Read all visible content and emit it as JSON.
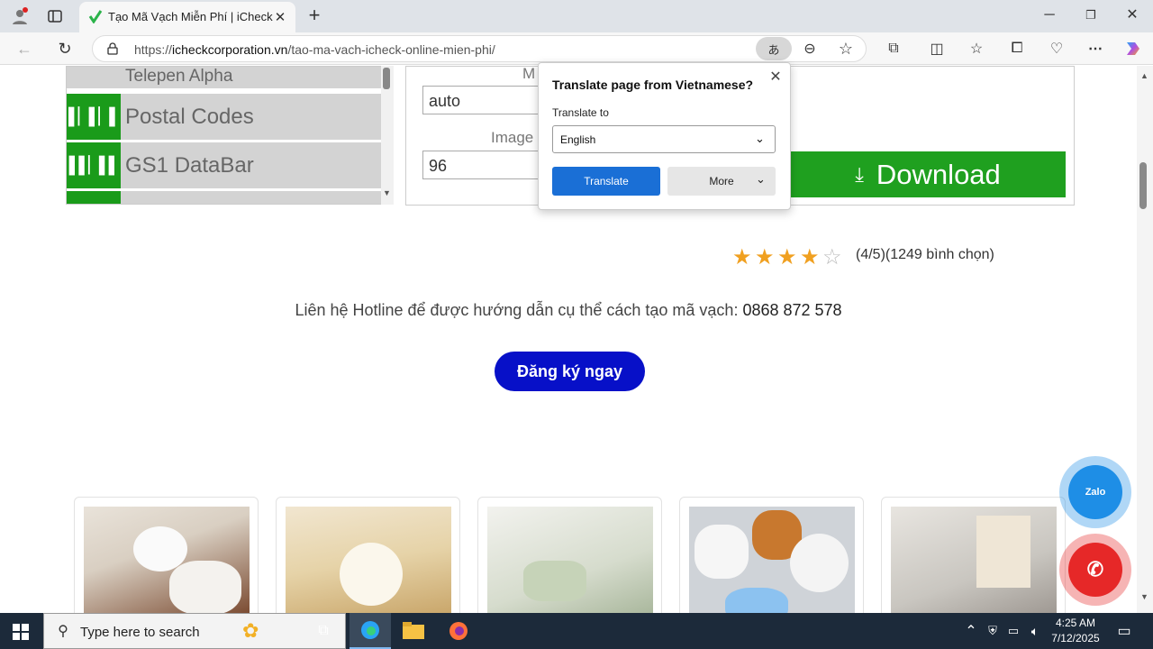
{
  "browser": {
    "tab_title": "Tạo Mã Vạch Miễn Phí | iCheck",
    "url_domain": "icheckcorporation.vn",
    "url_path": "/tao-ma-vach-icheck-online-mien-phi/",
    "url_prefix": "https://"
  },
  "barcode_list": {
    "items": [
      {
        "label": "Telepen Alpha"
      },
      {
        "label": "Postal Codes"
      },
      {
        "label": "GS1 DataBar"
      }
    ]
  },
  "form": {
    "label_m": "M",
    "margin_value": "auto",
    "label_image": "Image",
    "dpi_value": "96",
    "download_label": "Download"
  },
  "translate_popup": {
    "heading": "Translate page from Vietnamese?",
    "translate_to_label": "Translate to",
    "selected_language": "English",
    "translate_button": "Translate",
    "more_button": "More"
  },
  "rating": {
    "score": 4,
    "max": 5,
    "text": "(4/5)(1249 bình chọn)"
  },
  "contact": {
    "text": "Liên hệ Hotline để được hướng dẫn cụ thể cách tạo mã vạch: ",
    "phone": "0868 872 578",
    "register_button": "Đăng ký ngay"
  },
  "floating": {
    "zalo_label": "Zalo"
  },
  "taskbar": {
    "search_placeholder": "Type here to search",
    "time": "4:25 AM",
    "date": "7/12/2025"
  },
  "colors": {
    "green": "#1fa01f",
    "blue_button": "#0710c8",
    "translate_blue": "#1a6fd6",
    "star": "#f0a020"
  }
}
